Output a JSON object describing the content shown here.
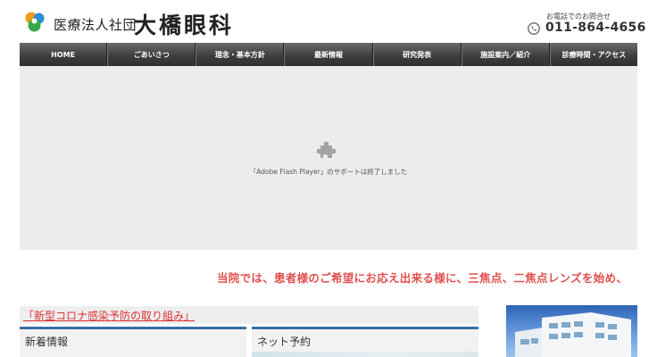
{
  "header": {
    "org_label": "医療法人社団",
    "clinic_name": "大橋眼科",
    "phone_caption": "お電話でのお問合せ",
    "phone_number": "011-864-4656"
  },
  "nav": {
    "items": [
      {
        "label": "HOME"
      },
      {
        "label": "ごあいさつ"
      },
      {
        "label": "理念・基本方針"
      },
      {
        "label": "最新情報"
      },
      {
        "label": "研究発表"
      },
      {
        "label": "施設案内／紹介"
      },
      {
        "label": "診療時間・アクセス"
      }
    ]
  },
  "flash": {
    "message": "「Adobe Flash Player」のサポートは終了しました",
    "icon": "puzzle-icon"
  },
  "marquee": {
    "text": "当院では、患者様のご希望にお応え出来る様に、三焦点、二焦点レンズを始め、"
  },
  "covid": {
    "link_text": "「新型コロナ感染予防の取り組み」"
  },
  "sections": {
    "news_title": "新着情報",
    "reserve_title": "ネット予約"
  },
  "colors": {
    "nav_bg": "#3f3f3f",
    "accent_red": "#e24f4f",
    "heading_border": "#3a6fa3",
    "flash_bg": "#ececec"
  }
}
